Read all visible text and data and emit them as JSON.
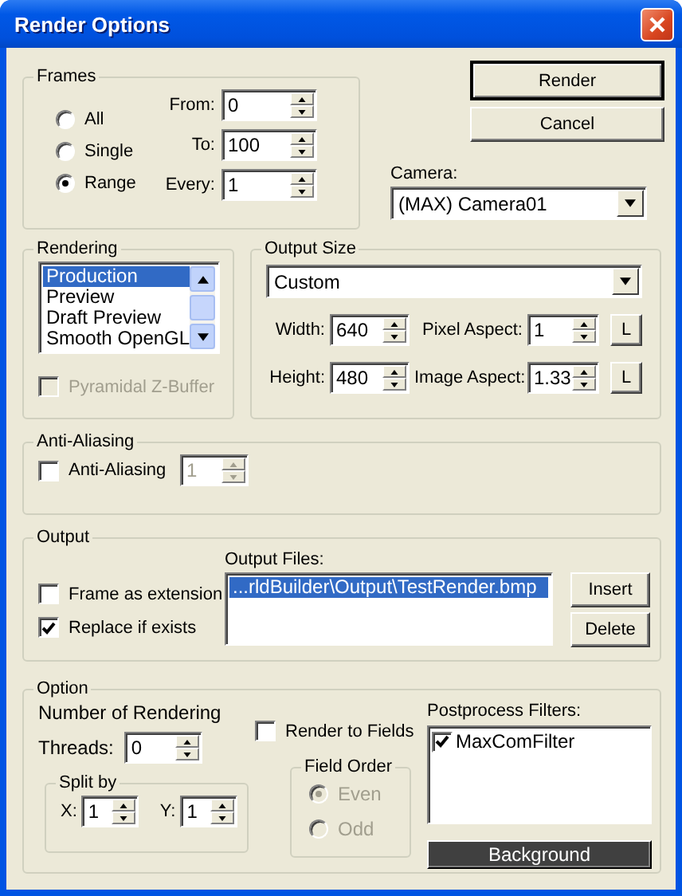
{
  "window": {
    "title": "Render Options"
  },
  "frames": {
    "title": "Frames",
    "modes": [
      {
        "label": "All",
        "selected": false
      },
      {
        "label": "Single",
        "selected": false
      },
      {
        "label": "Range",
        "selected": true
      }
    ],
    "fields": [
      {
        "label": "From:",
        "value": "0"
      },
      {
        "label": "To:",
        "value": "100"
      },
      {
        "label": "Every:",
        "value": "1"
      }
    ]
  },
  "buttons": [
    {
      "label": "Render",
      "default": true
    },
    {
      "label": "Cancel",
      "default": false
    }
  ],
  "camera": {
    "label": "Camera:",
    "value": "(MAX) Camera01"
  },
  "rendering": {
    "title": "Rendering",
    "items": [
      {
        "label": "Production",
        "selected": true
      },
      {
        "label": "Preview",
        "selected": false
      },
      {
        "label": "Draft Preview",
        "selected": false
      },
      {
        "label": "Smooth OpenGL",
        "selected": false
      }
    ],
    "pyramidal": {
      "label": "Pyramidal Z-Buffer",
      "checked": false,
      "disabled": true
    }
  },
  "output_size": {
    "title": "Output Size",
    "preset": "Custom",
    "rows": [
      {
        "label": "Width:",
        "value": "640",
        "aspect_label": "Pixel Aspect:",
        "aspect_value": "1",
        "lock": "L"
      },
      {
        "label": "Height:",
        "value": "480",
        "aspect_label": "Image Aspect:",
        "aspect_value": "1.33",
        "lock": "L"
      }
    ]
  },
  "anti_aliasing": {
    "title": "Anti-Aliasing",
    "label": "Anti-Aliasing",
    "checked": false,
    "value": "1",
    "disabled": true
  },
  "output": {
    "title": "Output",
    "options": [
      {
        "label": "Frame as extension",
        "checked": false
      },
      {
        "label": "Replace if exists",
        "checked": true
      }
    ],
    "files_label": "Output Files:",
    "files": [
      {
        "path": "...rldBuilder\\Output\\TestRender.bmp",
        "selected": true
      }
    ],
    "buttons": [
      "Insert",
      "Delete"
    ]
  },
  "option": {
    "title": "Option",
    "threads_intro": "Number of Rendering",
    "threads_label": "Threads:",
    "threads": "0",
    "split": {
      "title": "Split by",
      "fields": [
        {
          "label": "X:",
          "value": "1"
        },
        {
          "label": "Y:",
          "value": "1"
        }
      ]
    },
    "render_to_fields": {
      "label": "Render to Fields",
      "checked": false
    },
    "field_order": {
      "title": "Field Order",
      "disabled": true,
      "options": [
        {
          "label": "Even",
          "selected": true
        },
        {
          "label": "Odd",
          "selected": false
        }
      ]
    },
    "filters_label": "Postprocess Filters:",
    "filters": [
      {
        "label": "MaxComFilter",
        "checked": true
      }
    ],
    "background_button": "Background"
  }
}
